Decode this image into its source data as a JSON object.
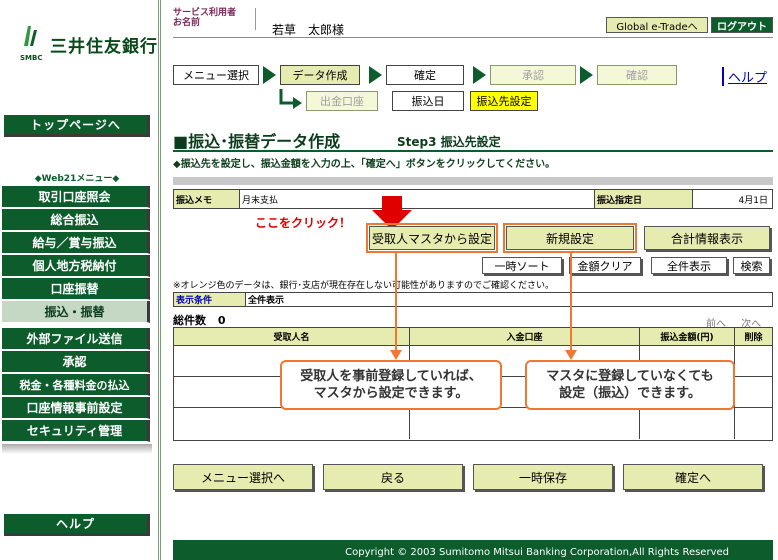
{
  "brand": {
    "name": "三井住友銀行",
    "sub": "SMBC"
  },
  "sidebar": {
    "top_button": "トップページへ",
    "web21_label": "◆Web21メニュー◆",
    "items": [
      {
        "label": "取引口座照会"
      },
      {
        "label": "総合振込"
      },
      {
        "label": "給与／賞与振込"
      },
      {
        "label": "個人地方税納付"
      },
      {
        "label": "口座振替"
      },
      {
        "label": "振込・振替"
      },
      {
        "label": "外部ファイル送信"
      },
      {
        "label": "承認"
      },
      {
        "label": "税金・各種料金の払込"
      },
      {
        "label": "口座情報事前設定"
      },
      {
        "label": "セキュリティ管理"
      }
    ],
    "active_item": "振込・振替",
    "help_button": "ヘルプ"
  },
  "header": {
    "user_label_1": "サービス利用者",
    "user_label_2": "お名前",
    "user_name": "若草　太郎様",
    "global_button": "Global e-Tradeへ",
    "logout_button": "ログアウト"
  },
  "steps": {
    "menu": "メニュー選択",
    "data": "データ作成",
    "confirm": "確定",
    "approve": "承認",
    "check": "確認",
    "help": "ヘルプ",
    "sub_from": "出金口座",
    "sub_date": "振込日",
    "sub_dest": "振込先設定"
  },
  "page": {
    "title": "■振込･振替データ作成",
    "step_label": "Step3 振込先設定",
    "instruction": "◆振込先を設定し、振込金額を入力の上、「確定へ」ボタンをクリックしてください。"
  },
  "memo": {
    "label": "振込メモ",
    "value": "月末支払",
    "date_label": "振込指定日",
    "date_value": "4月1日"
  },
  "actions": {
    "click_here": "ここをクリック！",
    "from_master": "受取人マスタから設定",
    "new": "新規設定",
    "summary": "合計情報表示",
    "sort": "一時ソート",
    "clear": "金額クリア",
    "show_all": "全件表示",
    "search": "検索"
  },
  "note": "※オレンジ色のデータは、銀行･支店が現在存在しない可能性がありますのでご確認ください。",
  "filter": {
    "label": "表示条件",
    "value": "全件表示"
  },
  "results": {
    "count_label": "総件数",
    "count": "0",
    "prev": "前へ",
    "next": "次へ",
    "columns": [
      "受取人名",
      "入金口座",
      "振込金額(円)",
      "削除"
    ]
  },
  "callouts": {
    "left": [
      "受取人を事前登録していれば、",
      "マスタから設定できます。"
    ],
    "right": [
      "マスタに登録していなくても",
      "設定（振込）できます。"
    ]
  },
  "bottom": {
    "menu": "メニュー選択へ",
    "back": "戻る",
    "save": "一時保存",
    "confirm": "確定へ"
  },
  "footer": "Copyright © 2003 Sumitomo Mitsui Banking Corporation,All Rights Reserved",
  "colors": {
    "primary": "#0c5c2c",
    "accent": "#f07830",
    "button": "#e6ebaf",
    "alert": "#e00000"
  }
}
